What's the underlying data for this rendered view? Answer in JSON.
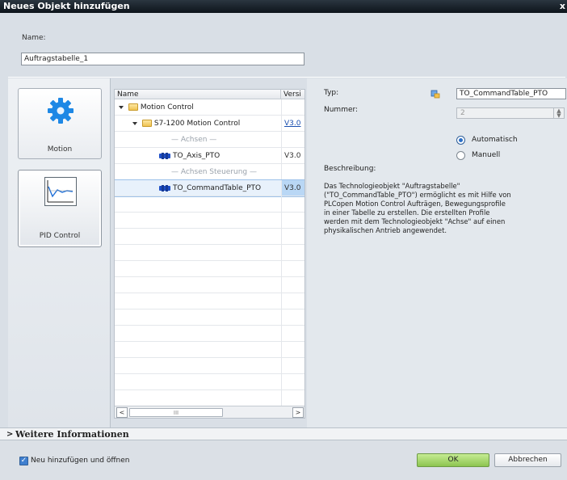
{
  "window": {
    "title": "Neues Objekt hinzufügen",
    "close_glyph": "x"
  },
  "name": {
    "label": "Name:",
    "value": "Auftragstabelle_1"
  },
  "categories": [
    {
      "label": "Motion",
      "icon": "gear-icon"
    },
    {
      "label": "PID Control",
      "icon": "pid-graph-icon"
    }
  ],
  "tree": {
    "columns": {
      "name": "Name",
      "version": "Versi"
    },
    "rows": [
      {
        "label": "Motion Control",
        "version": ""
      },
      {
        "label": "S7-1200 Motion Control",
        "version": "V3.0"
      },
      {
        "label": "— Achsen —",
        "version": ""
      },
      {
        "label": "TO_Axis_PTO",
        "version": "V3.0"
      },
      {
        "label": "— Achsen Steuerung —",
        "version": ""
      },
      {
        "label": "TO_CommandTable_PTO",
        "version": "V3.0"
      }
    ],
    "scroll_left": "<",
    "scroll_right": ">",
    "scroll_thumb": "III"
  },
  "details": {
    "typ_label": "Typ:",
    "typ_value": "TO_CommandTable_PTO",
    "nummer_label": "Nummer:",
    "nummer_value": "2",
    "radio_auto": "Automatisch",
    "radio_manual": "Manuell",
    "beschreibung_label": "Beschreibung:",
    "beschreibung_text": "Das Technologieobjekt \"Auftragstabelle\"\n(\"TO_CommandTable_PTO\") ermöglicht es mit Hilfe von\nPLCopen Motion Control Aufträgen, Bewegungsprofile\nin einer Tabelle zu erstellen. Die erstellten Profile\nwerden mit dem Technologieobjekt \"Achse\" auf einen\nphysikalischen Antrieb angewendet."
  },
  "more_info": {
    "arrow": ">",
    "label": "Weitere Informationen"
  },
  "footer": {
    "checkbox_label": "Neu hinzufügen und öffnen",
    "ok": "OK",
    "cancel": "Abbrechen"
  },
  "colors": {
    "selection": "#b9d7f5",
    "ok_button": "#9fd064",
    "title_bar": "#1a232c",
    "gear": "#1e88e5"
  }
}
